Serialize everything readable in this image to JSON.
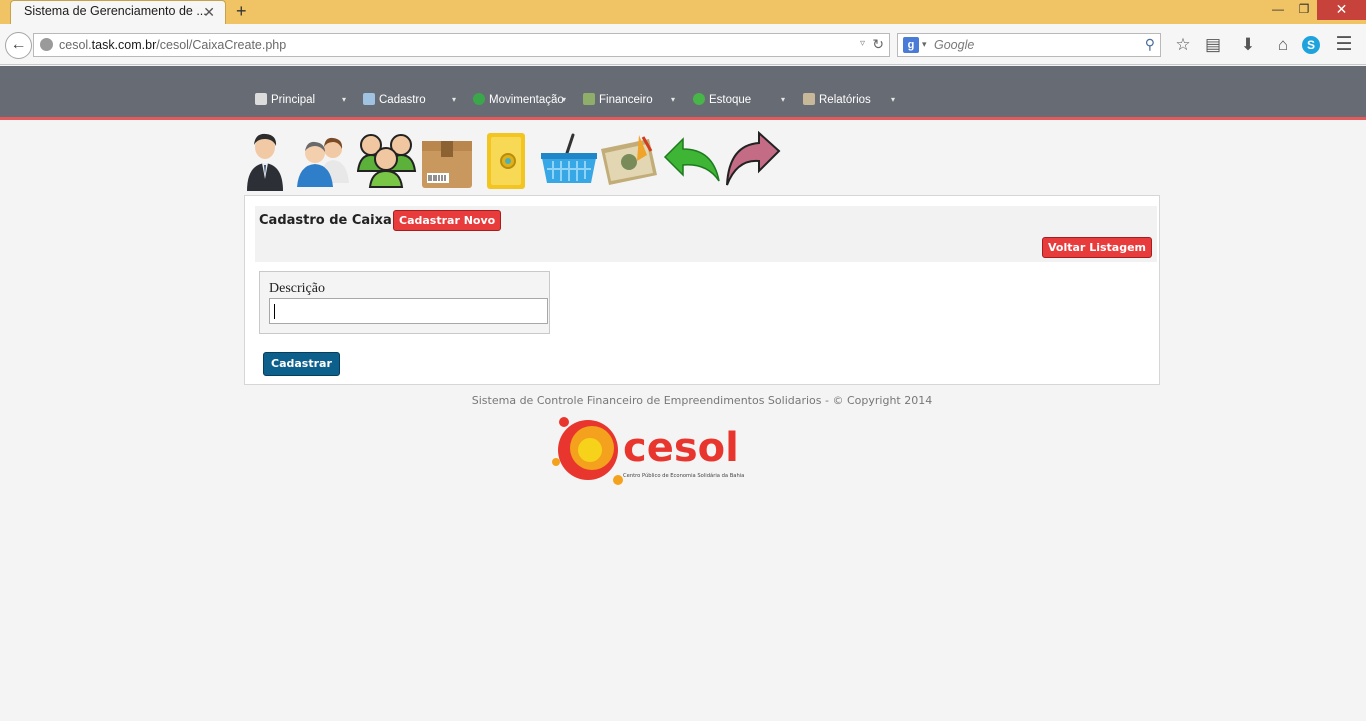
{
  "browser": {
    "tab_title": "Sistema de Gerenciamento de ...",
    "tab_close": "✕",
    "new_tab": "+",
    "url_prefix": "cesol.",
    "url_domain": "task.com.br",
    "url_path": "/cesol/CaixaCreate.php",
    "search_placeholder": "Google",
    "search_engine_letter": "g",
    "icons": [
      "back-arrow-icon",
      "globe-icon",
      "reload-icon",
      "search-icon",
      "star-icon",
      "reading-list-icon",
      "download-icon",
      "home-icon",
      "skype-icon",
      "hamburger-menu-icon"
    ]
  },
  "menu": {
    "items": [
      {
        "label": "Principal",
        "icon": "home-icon",
        "color": "#dcdcdc"
      },
      {
        "label": "Cadastro",
        "icon": "card-icon",
        "color": "#9fc3e0"
      },
      {
        "label": "Movimentação",
        "icon": "refresh-icon",
        "color": "#3aa84a"
      },
      {
        "label": "Financeiro",
        "icon": "money-icon",
        "color": "#8fae6a"
      },
      {
        "label": "Estoque",
        "icon": "recycle-icon",
        "color": "#48b548"
      },
      {
        "label": "Relatórios",
        "icon": "report-icon",
        "color": "#c8b89a"
      }
    ],
    "caret": "▾",
    "accent": "#e25a5a",
    "bg": "#676b73"
  },
  "toolbar": {
    "icons": [
      "user-icon",
      "users-icon",
      "group-icon",
      "box-icon",
      "safe-icon",
      "basket-icon",
      "cash-icon",
      "undo-arrow-icon",
      "redo-arrow-icon"
    ]
  },
  "panel": {
    "title": "Cadastro de Caixa:",
    "new_button": "Cadastrar Novo",
    "back_button": "Voltar Listagem",
    "field_label": "Descrição",
    "field_value": "",
    "submit_button": "Cadastrar"
  },
  "footer": {
    "text": "Sistema de Controle Financeiro de Empreendimentos Solidarios - © Copyright 2014",
    "logo_text": "cesol",
    "logo_subtitle": "Centro Público de Economia Solidária da Bahia",
    "logo_colors": [
      "#e8362e",
      "#f4a21d",
      "#f7d21a"
    ]
  }
}
